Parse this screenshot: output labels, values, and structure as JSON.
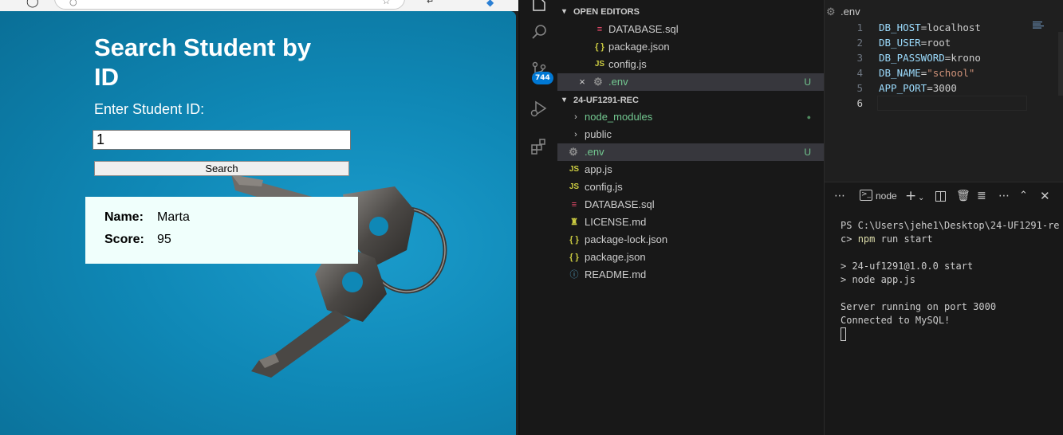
{
  "browser": {
    "page": {
      "title": "Search Student by ID",
      "prompt_label": "Enter Student ID:",
      "student_id_value": "1",
      "search_button": "Search",
      "result": {
        "name_label": "Name:",
        "name_value": "Marta",
        "score_label": "Score:",
        "score_value": "95"
      }
    }
  },
  "vscode": {
    "activity_bar": {
      "source_control_badge": "744",
      "icons": [
        "explorer-icon",
        "search-icon",
        "source-control-icon",
        "run-debug-icon",
        "extensions-icon"
      ]
    },
    "explorer": {
      "open_editors_header": "OPEN EDITORS",
      "open_editors": [
        {
          "name": "DATABASE.sql",
          "icon": "database-icon"
        },
        {
          "name": "package.json",
          "icon": "json-icon",
          "glyph": "{ }"
        },
        {
          "name": "config.js",
          "icon": "js-icon",
          "glyph": "JS"
        },
        {
          "name": ".env",
          "icon": "gear-icon",
          "status": "U"
        }
      ],
      "project_header": "24-UF1291-REC",
      "files": [
        {
          "name": "node_modules",
          "type": "folder"
        },
        {
          "name": "public",
          "type": "folder"
        },
        {
          "name": ".env",
          "icon": "gear-icon",
          "status": "U"
        },
        {
          "name": "app.js",
          "icon": "js-icon",
          "glyph": "JS"
        },
        {
          "name": "config.js",
          "icon": "js-icon",
          "glyph": "JS"
        },
        {
          "name": "DATABASE.sql",
          "icon": "database-icon"
        },
        {
          "name": "LICENSE.md",
          "icon": "license-icon"
        },
        {
          "name": "package-lock.json",
          "icon": "json-icon",
          "glyph": "{ }"
        },
        {
          "name": "package.json",
          "icon": "json-icon",
          "glyph": "{ }"
        },
        {
          "name": "README.md",
          "icon": "info-icon",
          "glyph": "ⓘ"
        }
      ]
    },
    "editor": {
      "tab_label": ".env",
      "lines": [
        {
          "no": "1",
          "key": "DB_HOST",
          "value": "localhost"
        },
        {
          "no": "2",
          "key": "DB_USER",
          "value": "root"
        },
        {
          "no": "3",
          "key": "DB_PASSWORD",
          "value": "krono"
        },
        {
          "no": "4",
          "key": "DB_NAME",
          "value": "\"school\""
        },
        {
          "no": "5",
          "key": "APP_PORT",
          "value": "3000"
        },
        {
          "no": "6",
          "key": "",
          "value": ""
        }
      ],
      "eq": "="
    },
    "terminal": {
      "tab_label": "node",
      "lines": [
        "PS C:\\Users\\jehe1\\Desktop\\24-UF1291-re",
        "c> npm run start",
        "",
        "> 24-uf1291@1.0.0 start",
        "> node app.js",
        "",
        "Server running on port 3000",
        "Connected to MySQL!"
      ]
    },
    "colors": {
      "env_key": "#9cdcfe",
      "env_value": "#cccccc",
      "env_string": "#ce9178",
      "modified_green": "#73c991",
      "npm_yellow": "#dcdcaa"
    }
  }
}
